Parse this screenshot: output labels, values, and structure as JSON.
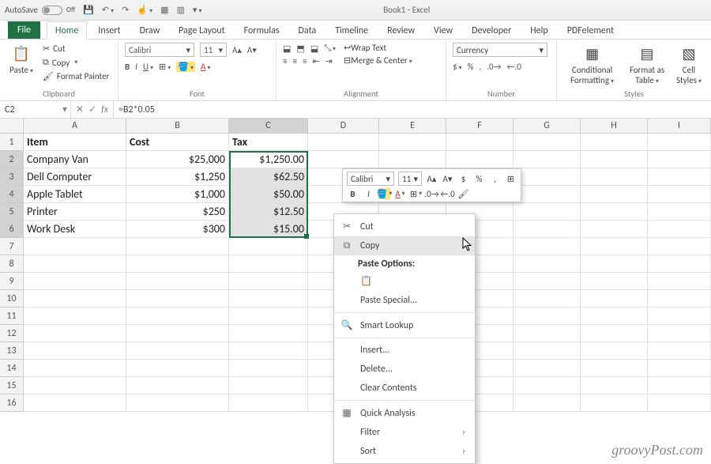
{
  "title": "Book1 - Excel",
  "autosave": {
    "label": "AutoSave",
    "state": "Off"
  },
  "tabs": [
    "File",
    "Home",
    "Insert",
    "Draw",
    "Page Layout",
    "Formulas",
    "Data",
    "Timeline",
    "Review",
    "View",
    "Developer",
    "Help",
    "PDFelement"
  ],
  "activeTab": "Home",
  "clipboard": {
    "paste": "Paste",
    "cut": "Cut",
    "copy": "Copy",
    "painter": "Format Painter",
    "groupLabel": "Clipboard"
  },
  "font": {
    "name": "Calibri",
    "size": "11",
    "groupLabel": "Font"
  },
  "alignment": {
    "wrap": "Wrap Text",
    "merge": "Merge & Center",
    "groupLabel": "Alignment"
  },
  "number": {
    "format": "Currency",
    "groupLabel": "Number"
  },
  "styles": {
    "cond": "Conditional Formatting",
    "table": "Format as Table",
    "cell": "Cell Styles",
    "groupLabel": "Styles"
  },
  "namebox": "C2",
  "formula": "=B2*0.05",
  "columns": [
    "A",
    "B",
    "C",
    "D",
    "E",
    "F",
    "G",
    "H",
    "I"
  ],
  "headers": {
    "A": "Item",
    "B": "Cost",
    "C": "Tax"
  },
  "data": [
    {
      "item": "Company Van",
      "cost": "$25,000",
      "tax": "$1,250.00"
    },
    {
      "item": "Dell Computer",
      "cost": "$1,250",
      "tax": "$62.50"
    },
    {
      "item": "Apple Tablet",
      "cost": "$1,000",
      "tax": "$50.00"
    },
    {
      "item": "Printer",
      "cost": "$250",
      "tax": "$12.50"
    },
    {
      "item": "Work Desk",
      "cost": "$300",
      "tax": "$15.00"
    }
  ],
  "minitoolbar": {
    "font": "Calibri",
    "size": "11"
  },
  "contextMenu": {
    "cut": "Cut",
    "copy": "Copy",
    "pasteOptions": "Paste Options:",
    "pasteSpecial": "Paste Special...",
    "smartLookup": "Smart Lookup",
    "insert": "Insert...",
    "delete": "Delete...",
    "clear": "Clear Contents",
    "quick": "Quick Analysis",
    "filter": "Filter",
    "sort": "Sort"
  },
  "watermark": "groovyPost.com"
}
